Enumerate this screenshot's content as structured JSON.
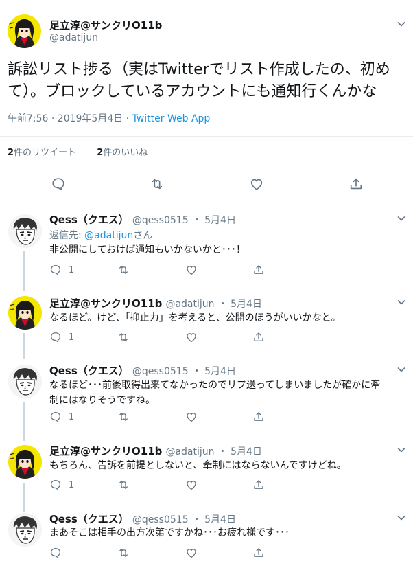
{
  "main": {
    "author_name": "足立淳@サンクリO11b",
    "author_handle": "@adatijun",
    "text_line1": "訴訟リスト捗る（実はTwitterでリスト作成したの、初め",
    "text_line2": "て）。ブロックしているアカウントにも通知行くんかな",
    "time": "午前7:56 · 2019年5月4日 · ",
    "source": "Twitter Web App",
    "retweet_count": "2",
    "retweet_label": "件のリツイート",
    "like_count": "2",
    "like_label": "件のいいね"
  },
  "replies": [
    {
      "name": "Qess（クエス）",
      "handle": "@qess0515",
      "date": "・ 5月4日",
      "reply_to_label": "返信先: ",
      "reply_to_handle": "@adatijun",
      "reply_to_suffix": "さん",
      "text": "非公開にしておけば通知もいかないかと･･･！",
      "reply_count": "1"
    },
    {
      "name": "足立淳@サンクリO11b",
      "handle": "@adatijun",
      "date": "・ 5月4日",
      "text": "なるほど。けど、「抑止力」を考えると、公開のほうがいいかなと。",
      "reply_count": "1"
    },
    {
      "name": "Qess（クエス）",
      "handle": "@qess0515",
      "date": "・ 5月4日",
      "text_line1": "なるほど･･･前後取得出来てなかったのでリプ送ってしまいましたが確かに牽",
      "text_line2": "制にはなりそうですね。",
      "reply_count": "1"
    },
    {
      "name": "足立淳@サンクリO11b",
      "handle": "@adatijun",
      "date": "・ 5月4日",
      "text": "もちろん、告訴を前提としないと、牽制にはならないんですけどね。",
      "reply_count": "1"
    },
    {
      "name": "Qess（クエス）",
      "handle": "@qess0515",
      "date": "・ 5月4日",
      "text": "まあそこは相手の出方次第ですかね･･･お疲れ様です･･･",
      "reply_count": ""
    }
  ],
  "icons": {
    "reply": "reply-icon",
    "retweet": "retweet-icon",
    "like": "heart-icon",
    "share": "share-icon",
    "menu": "chevron-down-icon"
  },
  "colors": {
    "link": "#1b95e0",
    "muted": "#657786",
    "divider": "#e6ecf0",
    "thread": "#ccd6dd",
    "avatar_adatijun_bg": "#f5e600"
  }
}
